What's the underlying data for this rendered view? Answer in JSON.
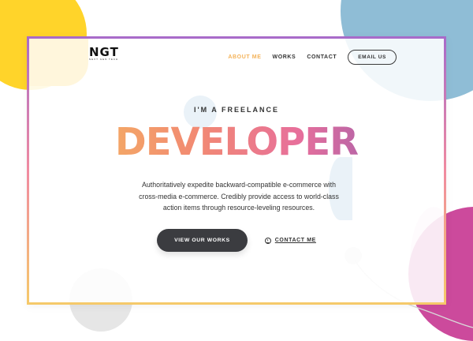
{
  "brand": {
    "logo_text": "NGT",
    "logo_subtext": "NEXT GEN TECH"
  },
  "nav": {
    "items": [
      {
        "label": "ABOUT ME",
        "active": true
      },
      {
        "label": "WORKS",
        "active": false
      },
      {
        "label": "CONTACT",
        "active": false
      }
    ],
    "email_button": "EMAIL US"
  },
  "hero": {
    "eyebrow": "I'M A FREELANCE",
    "headline": "DEVELOPER",
    "description": "Authoritatively expedite backward-compatible e-commerce with cross-media e-commerce. Credibly provide access to world-class action items through resource-leveling resources.",
    "primary_button": "VIEW OUR WORKS",
    "secondary_link": "CONTACT ME"
  },
  "icons": {
    "contact_link_icon": "arrow-circle-icon"
  },
  "colors": {
    "accent_active_nav": "#f4b35a",
    "primary_button_bg": "#3b3c40",
    "gradient": [
      "#f5c45a",
      "#f28a72",
      "#e76f9b",
      "#7e59b6"
    ],
    "yellow_shape": "#ffd42a",
    "blue_shape": "#8fbdd6",
    "magenta_shape": "#cc4a9c"
  }
}
